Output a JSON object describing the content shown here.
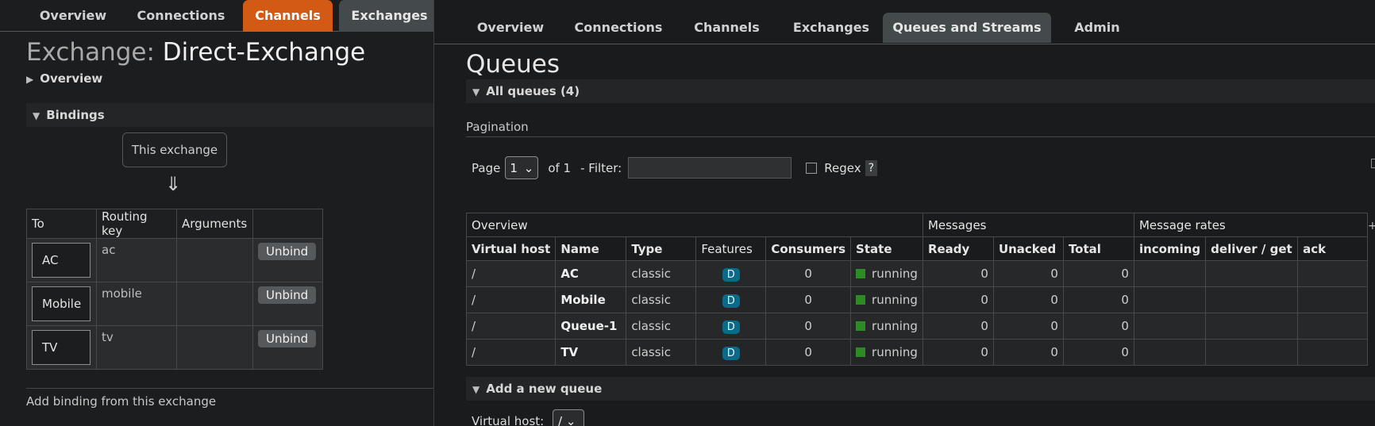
{
  "left": {
    "tabs": [
      {
        "label": "Overview"
      },
      {
        "label": "Connections"
      },
      {
        "label": "Channels"
      },
      {
        "label": "Exchanges"
      }
    ],
    "title_label": "Exchange:",
    "title_value": "Direct-Exchange",
    "overview_section": "Overview",
    "bindings_section": "Bindings",
    "this_exchange": "This exchange",
    "down_arrow": "⇓",
    "bindings_table": {
      "headers": [
        "To",
        "Routing key",
        "Arguments",
        ""
      ],
      "rows": [
        {
          "to": "AC",
          "routing_key": "ac",
          "arguments": "",
          "action": "Unbind"
        },
        {
          "to": "Mobile",
          "routing_key": "mobile",
          "arguments": "",
          "action": "Unbind"
        },
        {
          "to": "TV",
          "routing_key": "tv",
          "arguments": "",
          "action": "Unbind"
        }
      ]
    },
    "add_binding": "Add binding from this exchange"
  },
  "right": {
    "tabs": [
      {
        "label": "Overview"
      },
      {
        "label": "Connections"
      },
      {
        "label": "Channels"
      },
      {
        "label": "Exchanges"
      },
      {
        "label": "Queues and Streams"
      },
      {
        "label": "Admin"
      }
    ],
    "title": "Queues",
    "all_queues_section": "All queues (4)",
    "pagination_label": "Pagination",
    "pager": {
      "page_label": "Page",
      "page_value": "1",
      "of_label": "of 1",
      "filter_label": "- Filter:",
      "regex_label": "Regex",
      "help": "?"
    },
    "table": {
      "groups": [
        "Overview",
        "Messages",
        "Message rates"
      ],
      "columns": [
        "Virtual host",
        "Name",
        "Type",
        "Features",
        "Consumers",
        "State",
        "Ready",
        "Unacked",
        "Total",
        "incoming",
        "deliver / get",
        "ack"
      ],
      "rows": [
        {
          "vhost": "/",
          "name": "AC",
          "type": "classic",
          "features": "D",
          "consumers": "0",
          "state": "running",
          "ready": "0",
          "unacked": "0",
          "total": "0"
        },
        {
          "vhost": "/",
          "name": "Mobile",
          "type": "classic",
          "features": "D",
          "consumers": "0",
          "state": "running",
          "ready": "0",
          "unacked": "0",
          "total": "0"
        },
        {
          "vhost": "/",
          "name": "Queue-1",
          "type": "classic",
          "features": "D",
          "consumers": "0",
          "state": "running",
          "ready": "0",
          "unacked": "0",
          "total": "0"
        },
        {
          "vhost": "/",
          "name": "TV",
          "type": "classic",
          "features": "D",
          "consumers": "0",
          "state": "running",
          "ready": "0",
          "unacked": "0",
          "total": "0"
        }
      ],
      "plus": "+"
    },
    "add_queue_section": "Add a new queue",
    "virtual_host_label": "Virtual host:",
    "virtual_host_value": "/"
  },
  "colors": {
    "channels_tab": "#d35a14",
    "selected_tab": "#44494c",
    "feature_badge": "#0b6a87",
    "running_state": "#2e8a25"
  }
}
